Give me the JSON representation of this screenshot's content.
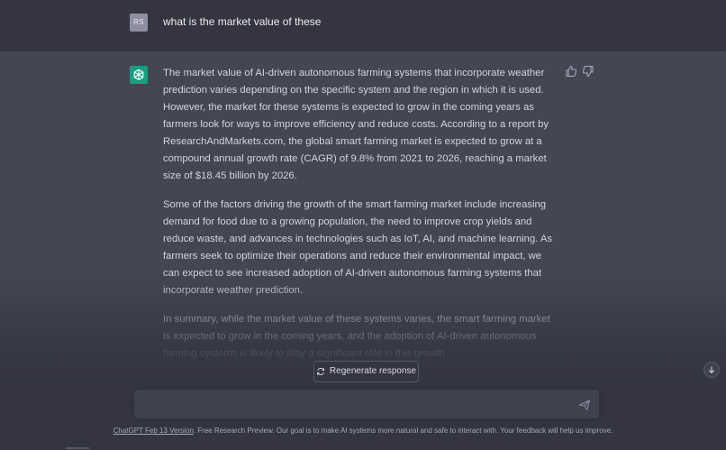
{
  "user_message": {
    "avatar_initials": "RS",
    "text": "what is the market value of these"
  },
  "assistant_message": {
    "avatar_icon": "openai-logo-icon",
    "paragraphs": [
      "The market value of AI-driven autonomous farming systems that incorporate weather prediction varies depending on the specific system and the region in which it is used. However, the market for these systems is expected to grow in the coming years as farmers look for ways to improve efficiency and reduce costs. According to a report by ResearchAndMarkets.com, the global smart farming market is expected to grow at a compound annual growth rate (CAGR) of 9.8% from 2021 to 2026, reaching a market size of $18.45 billion by 2026.",
      "Some of the factors driving the growth of the smart farming market include increasing demand for food due to a growing population, the need to improve crop yields and reduce waste, and advances in technologies such as IoT, AI, and machine learning. As farmers seek to optimize their operations and reduce their environmental impact, we can expect to see increased adoption of AI-driven autonomous farming systems that incorporate weather prediction.",
      "In summary, while the market value of these systems varies, the smart farming market is expected to grow in the coming years, and the adoption of AI-driven autonomous farming systems is likely to play a significant role in this growth."
    ],
    "feedback_icons": [
      "thumbs-up-icon",
      "thumbs-down-icon"
    ]
  },
  "controls": {
    "regenerate_label": "Regenerate response",
    "input_value": "",
    "send_icon": "send-icon",
    "scroll_icon": "arrow-down-icon"
  },
  "footer": {
    "link_text": "ChatGPT Feb 13 Version",
    "text": ". Free Research Preview. Our goal is to make AI systems more natural and safe to interact with. Your feedback will help us improve."
  },
  "colors": {
    "background": "#343541",
    "assistant_background": "#444654",
    "accent": "#10a37f"
  }
}
